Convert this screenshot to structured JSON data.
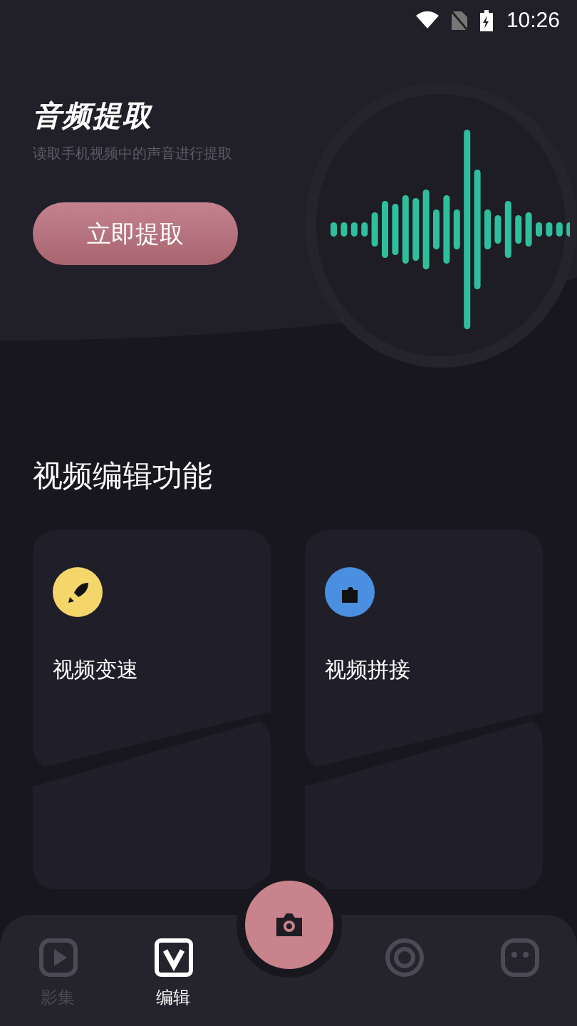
{
  "status_bar": {
    "time": "10:26"
  },
  "hero": {
    "title": "音频提取",
    "subtitle": "读取手机视频中的声音进行提取",
    "button": "立即提取"
  },
  "section": {
    "title": "视频编辑功能"
  },
  "features": [
    {
      "label": "视频变速",
      "kind": "rocket",
      "color": "#f4d66b"
    },
    {
      "label": "视频拼接",
      "kind": "puzzle",
      "color": "#4a8fe0"
    }
  ],
  "bottom_nav": [
    {
      "kind": "play",
      "label": "影集",
      "selected": false
    },
    {
      "kind": "edit",
      "label": "编辑",
      "selected": true
    },
    {
      "kind": "camera"
    },
    {
      "kind": "swirl",
      "selected": false
    },
    {
      "kind": "face",
      "selected": false
    }
  ]
}
